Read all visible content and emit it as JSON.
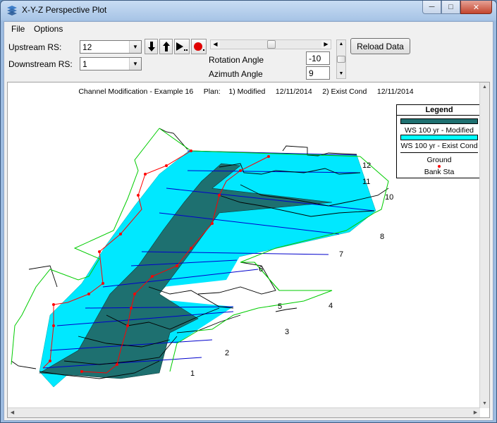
{
  "window": {
    "title": "X-Y-Z Perspective Plot"
  },
  "menu": {
    "file": "File",
    "options": "Options"
  },
  "toolbar": {
    "upstream_label": "Upstream RS:",
    "upstream_value": "12",
    "downstream_label": "Downstream RS:",
    "downstream_value": "1",
    "rotation_label": "Rotation Angle",
    "rotation_value": "-10",
    "azimuth_label": "Azimuth Angle",
    "azimuth_value": "9",
    "reload_label": "Reload Data"
  },
  "plot": {
    "header": "Channel Modification - Example 16     Plan:    1) Modified     12/11/2014     2) Exist Cond     12/11/2014",
    "legend": {
      "title": "Legend",
      "items": [
        {
          "label": "WS 100 yr - Modified",
          "color": "#1e7070"
        },
        {
          "label": "WS 100 yr - Exist Cond",
          "color": "#00ffff"
        },
        {
          "label": "Ground",
          "color": "#000000"
        },
        {
          "label": "Bank Sta",
          "color": "#ff0000"
        }
      ]
    },
    "colors": {
      "modified_ws": "#1e7070",
      "exist_ws": "#00e8ff",
      "ground": "#000000",
      "bank_sta": "#ff0000",
      "overbank": "#00cc00",
      "xs_line": "#0000cc"
    },
    "river_stations": [
      "12",
      "11",
      "10",
      "8",
      "7",
      "6",
      "5",
      "4",
      "3",
      "2",
      "1"
    ]
  }
}
